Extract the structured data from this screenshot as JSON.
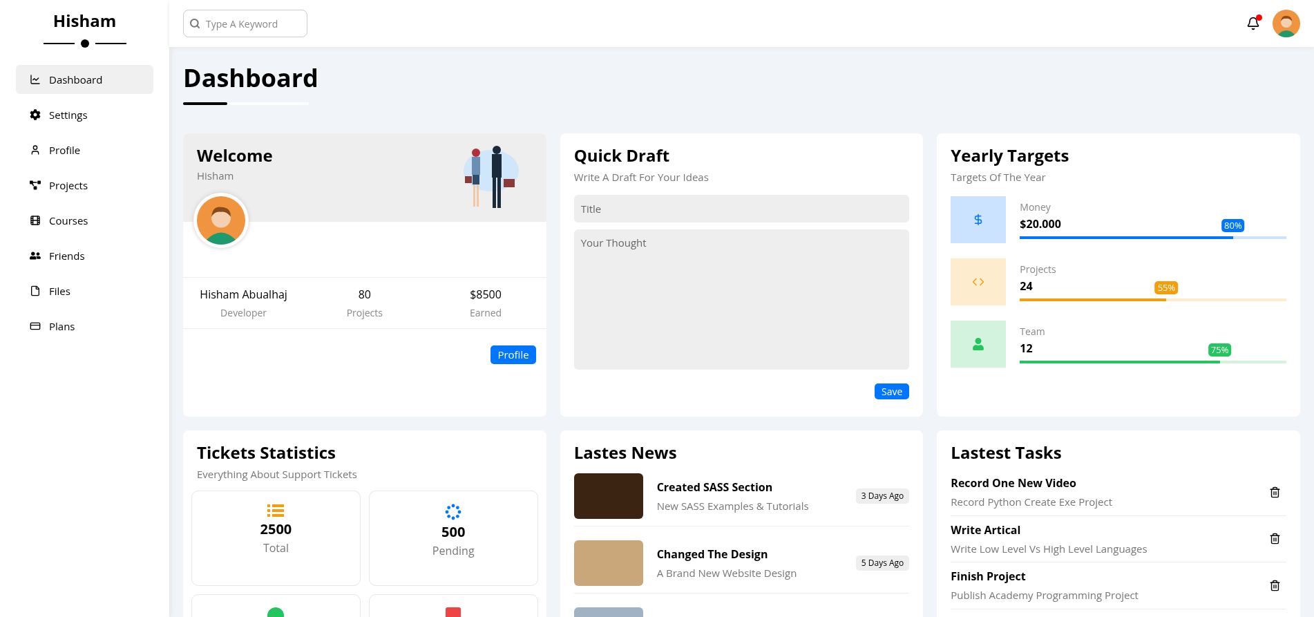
{
  "sidebar": {
    "brand": "Hisham",
    "items": [
      {
        "kind": "chart",
        "label": "Dashboard",
        "selected": true
      },
      {
        "kind": "gear",
        "label": "Settings",
        "selected": false
      },
      {
        "kind": "user",
        "label": "Profile",
        "selected": false
      },
      {
        "kind": "diagram",
        "label": "Projects",
        "selected": false
      },
      {
        "kind": "film",
        "label": "Courses",
        "selected": false
      },
      {
        "kind": "users",
        "label": "Friends",
        "selected": false
      },
      {
        "kind": "file",
        "label": "Files",
        "selected": false
      },
      {
        "kind": "card",
        "label": "Plans",
        "selected": false
      }
    ]
  },
  "header": {
    "search": {
      "placeholder": "Type A Keyword"
    },
    "notification_unread": true
  },
  "page_title": "Dashboard",
  "welcome": {
    "title": "Welcome",
    "subtitle": "Hisham",
    "stats": [
      {
        "value": "Hisham Abualhaj",
        "label": "Developer"
      },
      {
        "value": "80",
        "label": "Projects"
      },
      {
        "value": "$8500",
        "label": "Earned"
      }
    ],
    "button": "Profile"
  },
  "quick_draft": {
    "title": "Quick Draft",
    "subtitle": "Write A Draft For Your Ideas",
    "title_placeholder": "Title",
    "body_placeholder": "Your Thought",
    "button": "Save"
  },
  "yearly_targets": {
    "title": "Yearly Targets",
    "subtitle": "Targets Of The Year",
    "targets": [
      {
        "kind": "money",
        "label": "Money",
        "value": "$20.000",
        "level": 0.8,
        "reading": "80%",
        "color": "#0075ff"
      },
      {
        "kind": "code",
        "label": "Projects",
        "value": "24",
        "level": 0.55,
        "reading": "55%",
        "color": "#f59e0b"
      },
      {
        "kind": "user",
        "label": "Team",
        "value": "12",
        "level": 0.75,
        "reading": "75%",
        "color": "#22c55e"
      }
    ]
  },
  "tickets": {
    "title": "Tickets Statistics",
    "subtitle": "Everything About Support Tickets",
    "items": [
      {
        "kind": "list",
        "value": "2500",
        "label": "Total",
        "color": "#f59e0b"
      },
      {
        "kind": "spinner",
        "value": "500",
        "label": "Pending",
        "color": "#0075ff"
      },
      {
        "kind": "circle",
        "color": "#22c55e"
      },
      {
        "kind": "square",
        "color": "#ef4444"
      }
    ]
  },
  "news": {
    "title": "Lastes News",
    "items": [
      {
        "kind": "full",
        "title": "Created SASS Section",
        "description": "New SASS Examples & Tutorials",
        "time": "3 Days Ago"
      },
      {
        "kind": "full",
        "title": "Changed The Design",
        "description": "A Brand New Website Design",
        "time": "5 Days Ago"
      },
      {
        "kind": "cut"
      }
    ]
  },
  "tasks": {
    "title": "Lastest Tasks",
    "items": [
      {
        "title": "Record One New Video",
        "description": "Record Python Create Exe Project"
      },
      {
        "title": "Write Artical",
        "description": "Write Low Level Vs High Level Languages"
      },
      {
        "title": "Finish Project",
        "description": "Publish Academy Programming Project"
      }
    ]
  }
}
